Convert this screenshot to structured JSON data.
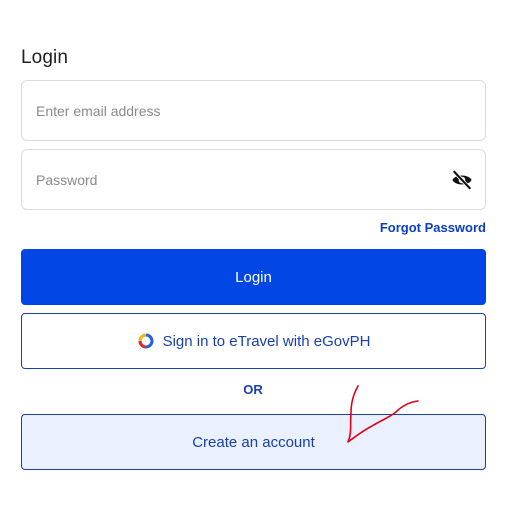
{
  "login": {
    "title": "Login",
    "email": {
      "placeholder": "Enter email address",
      "value": ""
    },
    "password": {
      "placeholder": "Password",
      "value": "",
      "toggle_icon": "eye-off-icon"
    },
    "forgot_password": "Forgot Password",
    "login_button": "Login",
    "egov_button": "Sign in to eTravel with eGovPH",
    "egov_icon": "egovph-ring-icon",
    "separator": "OR",
    "create_account_button": "Create an account"
  },
  "colors": {
    "primary": "#0246e6",
    "link": "#0a3ec9",
    "secondary_text": "#1a3faa",
    "create_bg": "#eaf0fd",
    "annotation": "#e3001b"
  }
}
